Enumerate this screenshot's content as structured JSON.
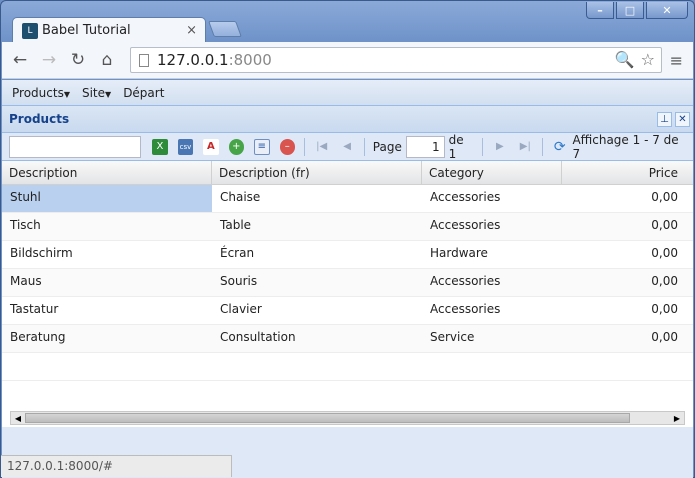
{
  "browser": {
    "tab_title": "Babel Tutorial",
    "tab_close": "×",
    "url_host": "127.0.0.1",
    "url_port": ":8000",
    "status_url": "127.0.0.1:8000/#"
  },
  "window": {
    "minimize": "–",
    "maximize": "□",
    "close": "✕"
  },
  "menu": {
    "products": "Products",
    "site": "Site",
    "depart": "Départ"
  },
  "panel": {
    "title": "Products"
  },
  "toolbar": {
    "page_label": "Page",
    "page_value": "1",
    "page_of": "de 1",
    "paging_info": "Affichage 1 - 7 de 7"
  },
  "grid": {
    "columns": [
      "Description",
      "Description (fr)",
      "Category",
      "Price"
    ],
    "rows": [
      [
        "Stuhl",
        "Chaise",
        "Accessories",
        "0,00"
      ],
      [
        "Tisch",
        "Table",
        "Accessories",
        "0,00"
      ],
      [
        "Bildschirm",
        "Écran",
        "Hardware",
        "0,00"
      ],
      [
        "Maus",
        "Souris",
        "Accessories",
        "0,00"
      ],
      [
        "Tastatur",
        "Clavier",
        "Accessories",
        "0,00"
      ],
      [
        "Beratung",
        "Consultation",
        "Service",
        "0,00"
      ]
    ]
  }
}
